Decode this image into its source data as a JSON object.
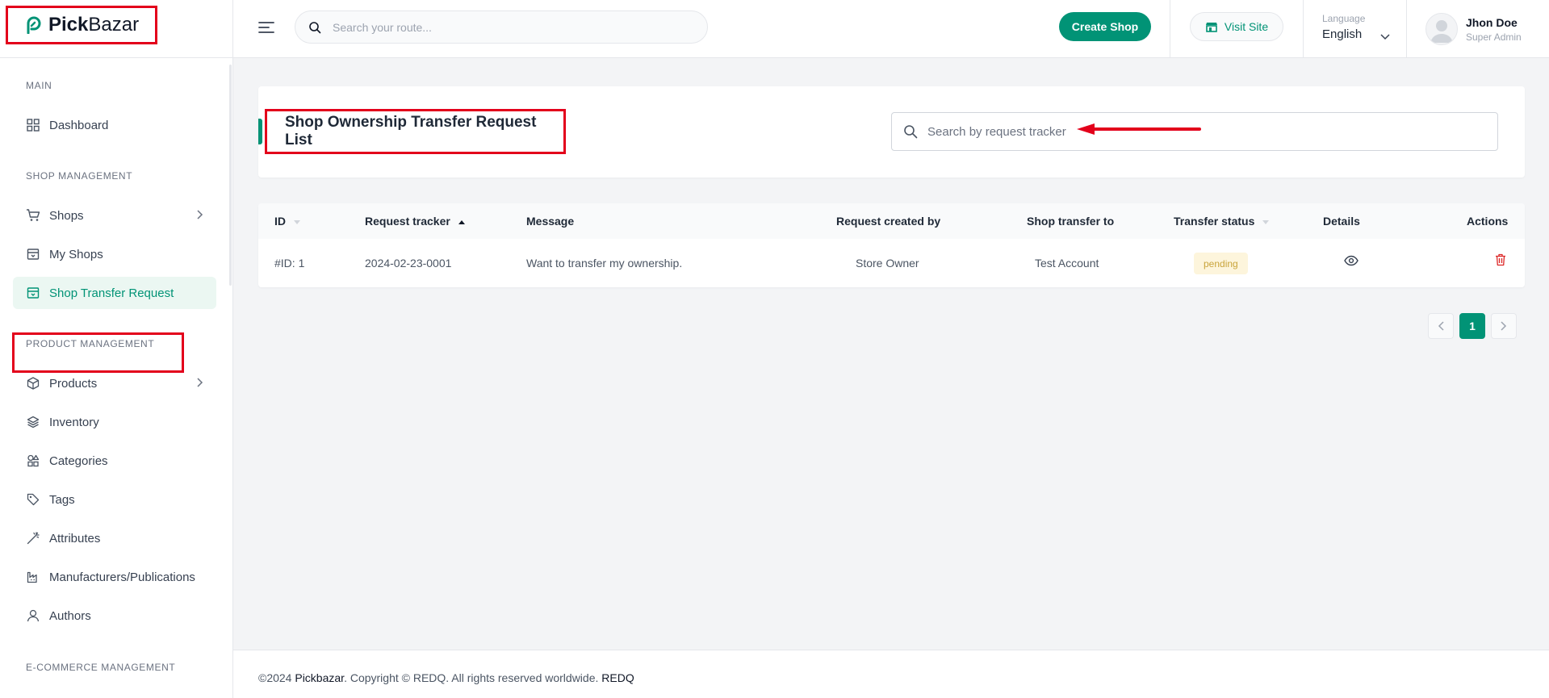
{
  "brand": {
    "name_bold": "Pick",
    "name_rest": "Bazar"
  },
  "topbar": {
    "search_placeholder": "Search your route...",
    "create_shop_label": "Create Shop",
    "visit_site_label": "Visit Site",
    "language_label": "Language",
    "language_value": "English",
    "user_name": "Jhon Doe",
    "user_role": "Super Admin"
  },
  "sidebar": {
    "sections": {
      "main": "MAIN",
      "shop_management": "SHOP MANAGEMENT",
      "product_management": "PRODUCT MANAGEMENT",
      "ecommerce_management": "E-COMMERCE MANAGEMENT"
    },
    "items": {
      "dashboard": "Dashboard",
      "shops": "Shops",
      "my_shops": "My Shops",
      "shop_transfer_request": "Shop Transfer Request",
      "products": "Products",
      "inventory": "Inventory",
      "categories": "Categories",
      "tags": "Tags",
      "attributes": "Attributes",
      "manufacturers": "Manufacturers/Publications",
      "authors": "Authors"
    },
    "active_item": "Shop Transfer Request"
  },
  "main": {
    "title": "Shop Ownership Transfer Request List",
    "search_placeholder": "Search by request tracker",
    "table": {
      "columns": {
        "id": "ID",
        "request_tracker": "Request tracker",
        "message": "Message",
        "created_by": "Request created by",
        "transfer_to": "Shop transfer to",
        "status": "Transfer status",
        "details": "Details",
        "actions": "Actions"
      },
      "rows": [
        {
          "id": "#ID: 1",
          "request_tracker": "2024-02-23-0001",
          "message": "Want to transfer my ownership.",
          "created_by": "Store Owner",
          "transfer_to": "Test Account",
          "status": "pending"
        }
      ]
    },
    "pagination": {
      "current_page": "1"
    }
  },
  "footer": {
    "prefix": "©2024 ",
    "brand": "Pickbazar",
    "middle": ". Copyright © REDQ. All rights reserved worldwide. ",
    "company": "REDQ"
  },
  "colors": {
    "accent": "#019376",
    "highlight": "#e3001b",
    "pending_bg": "#fdf5dc",
    "pending_text": "#c9a43b",
    "danger": "#dc2626"
  }
}
